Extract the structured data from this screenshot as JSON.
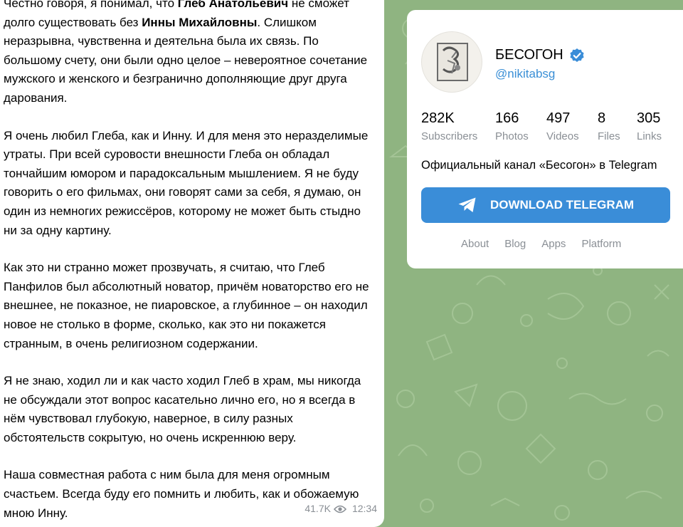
{
  "post": {
    "paragraphs": [
      [
        {
          "t": "Честно говоря, я понимал, что ",
          "b": false
        },
        {
          "t": "Глеб Анатольевич",
          "b": true
        },
        {
          "t": " не сможет долго существовать без ",
          "b": false
        },
        {
          "t": "Инны Михайловны",
          "b": true
        },
        {
          "t": ". Слишком неразрывна, чувственна и деятельна была их связь. По большому счету, они были одно целое – невероятное сочетание мужского и женского и безгранично дополняющие друг друга дарования.",
          "b": false
        }
      ],
      [
        {
          "t": "Я очень любил Глеба, как и Инну. И для меня это неразделимые утраты. При всей суровости внешности Глеба он обладал тончайшим юмором и парадоксальным мышлением. Я не буду говорить о его фильмах, они говорят сами за себя, я думаю, он один из немногих режиссёров, которому не может быть стыдно ни за одну картину.",
          "b": false
        }
      ],
      [
        {
          "t": "Как это ни странно может прозвучать, я считаю, что Глеб Панфилов был абсолютный новатор, причём новаторство его не внешнее, не показное, не пиаровское, а глубинное – он находил новое не столько в форме, сколько, как это ни покажется странным, в очень религиозном содержании.",
          "b": false
        }
      ],
      [
        {
          "t": "Я не знаю, ходил ли и как часто ходил Глеб в храм, мы никогда не обсуждали этот вопрос касательно лично его, но я всегда в нём чувствовал глубокую, наверное, в силу разных обстоятельств сокрытую, но очень искреннюю веру.",
          "b": false
        }
      ],
      [
        {
          "t": "Наша совместная работа с ним была для меня огромным счастьем. Всегда буду его помнить и любить, как и обожаемую мною Инну.",
          "b": false
        }
      ]
    ],
    "views": "41.7K",
    "time": "12:34"
  },
  "channel": {
    "name": "БЕСОГОН",
    "username": "@nikitabsg",
    "verified_icon": "verified-badge-icon",
    "stats": [
      {
        "value": "282K",
        "label": "Subscribers"
      },
      {
        "value": "166",
        "label": "Photos"
      },
      {
        "value": "497",
        "label": "Videos"
      },
      {
        "value": "8",
        "label": "Files"
      },
      {
        "value": "305",
        "label": "Links"
      }
    ],
    "description": "Официальный канал «Бесогон» в Telegram",
    "download_label": "DOWNLOAD TELEGRAM",
    "links": [
      "About",
      "Blog",
      "Apps",
      "Platform"
    ]
  },
  "colors": {
    "background": "#8fb481",
    "accent": "#3a8dd8",
    "link": "#3a8fd6",
    "muted": "#8a8f95"
  }
}
